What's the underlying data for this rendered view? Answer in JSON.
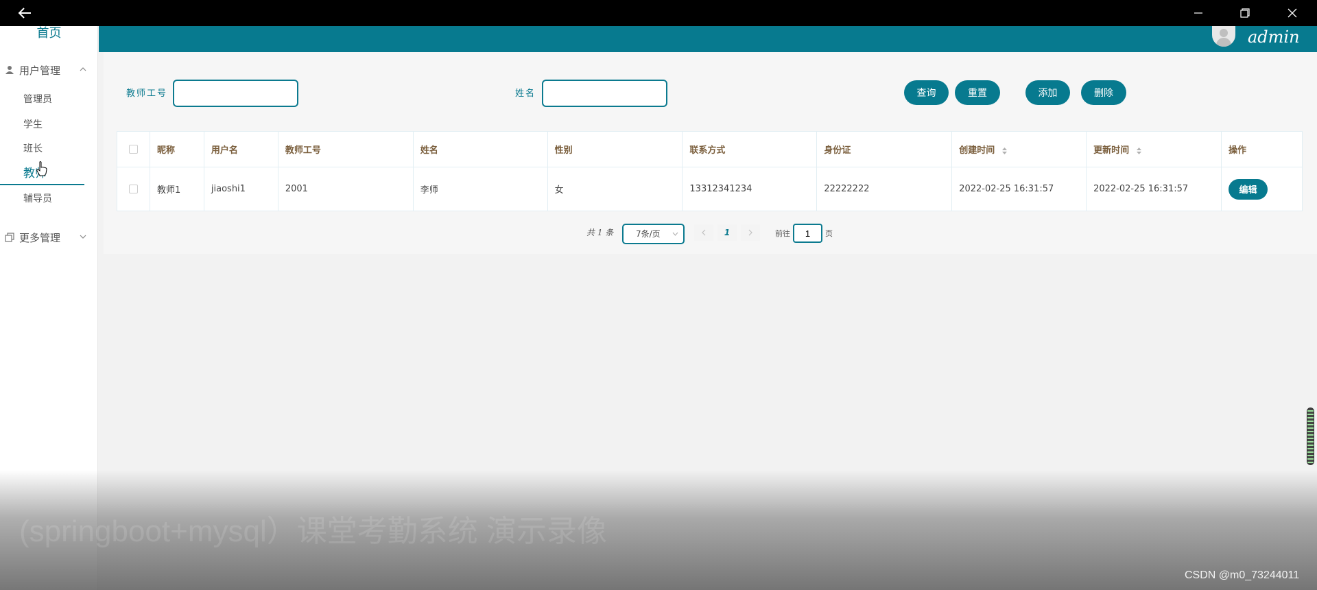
{
  "sidebar": {
    "home": "首页",
    "group_user": "用户管理",
    "items": [
      {
        "label": "管理员"
      },
      {
        "label": "学生"
      },
      {
        "label": "班长"
      },
      {
        "label": "教师"
      },
      {
        "label": "辅导员"
      }
    ],
    "group_more": "更多管理"
  },
  "header": {
    "user_name": "admin"
  },
  "search": {
    "teacher_no_label": "教师工号",
    "name_label": "姓名",
    "teacher_no_value": "",
    "name_value": ""
  },
  "buttons": {
    "query": "查询",
    "reset": "重置",
    "add": "添加",
    "delete": "删除"
  },
  "table": {
    "columns": [
      "昵称",
      "用户名",
      "教师工号",
      "姓名",
      "性别",
      "联系方式",
      "身份证",
      "创建时间",
      "更新时间",
      "操作"
    ],
    "rows": [
      {
        "nickname": "教师1",
        "username": "jiaoshi1",
        "teacher_no": "2001",
        "name": "李师",
        "gender": "女",
        "phone": "13312341234",
        "id_card": "22222222",
        "created": "2022-02-25 16:31:57",
        "updated": "2022-02-25 16:31:57",
        "action": "编辑"
      }
    ]
  },
  "pagination": {
    "total": "共 1 条",
    "page_size": "7条/页",
    "current_page": "1",
    "goto_label": "前往",
    "goto_value": "1",
    "goto_unit": "页"
  },
  "overlay": {
    "subtitle": "(springboot+mysql）课堂考勤系统 演示录像",
    "watermark": "CSDN @m0_73244011"
  },
  "colors": {
    "accent": "#077a8f",
    "header_text": "#7a5e3c"
  },
  "icons": [
    "back-arrow-icon",
    "minimize-icon",
    "restore-icon",
    "close-icon",
    "user-icon",
    "copy-icon",
    "chevron-up-icon",
    "chevron-down-icon",
    "sort-icon",
    "pointer-cursor-icon"
  ]
}
